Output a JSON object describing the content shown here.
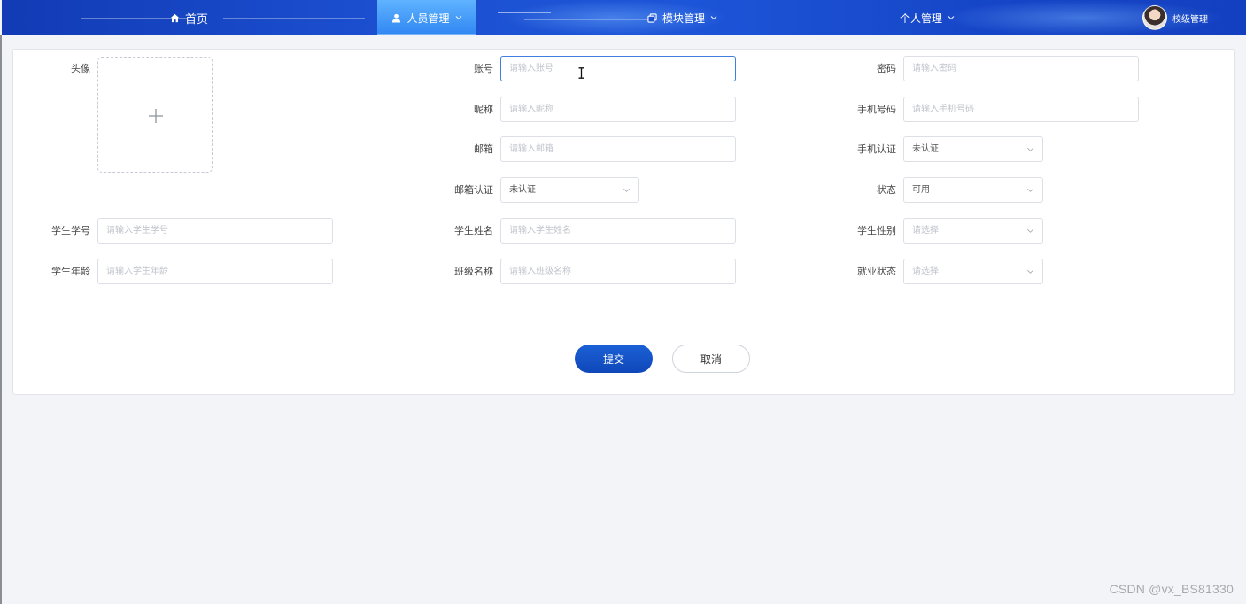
{
  "nav": {
    "home": "首页",
    "personnel": "人员管理",
    "modules": "模块管理",
    "personal": "个人管理",
    "user": "校级管理"
  },
  "form": {
    "avatar_label": "头像",
    "account_label": "账号",
    "account_placeholder": "请输入账号",
    "password_label": "密码",
    "password_placeholder": "请输入密码",
    "nickname_label": "昵称",
    "nickname_placeholder": "请输入昵称",
    "phone_label": "手机号码",
    "phone_placeholder": "请输入手机号码",
    "email_label": "邮箱",
    "email_placeholder": "请输入邮箱",
    "phone_verify_label": "手机认证",
    "phone_verify_value": "未认证",
    "email_verify_label": "邮箱认证",
    "email_verify_value": "未认证",
    "status_label": "状态",
    "status_value": "可用",
    "student_id_label": "学生学号",
    "student_id_placeholder": "请输入学生学号",
    "student_name_label": "学生姓名",
    "student_name_placeholder": "请输入学生姓名",
    "gender_label": "学生性别",
    "gender_placeholder": "请选择",
    "age_label": "学生年龄",
    "age_placeholder": "请输入学生年龄",
    "class_label": "班级名称",
    "class_placeholder": "请输入班级名称",
    "employment_label": "就业状态",
    "employment_placeholder": "请选择"
  },
  "buttons": {
    "submit": "提交",
    "cancel": "取消"
  },
  "watermark": "CSDN @vx_BS81330",
  "colors": {
    "nav_bg": "#1b4fd0",
    "nav_active": "#3b93f5",
    "primary_button": "#1553c9",
    "focus_border": "#3f7fe0"
  }
}
